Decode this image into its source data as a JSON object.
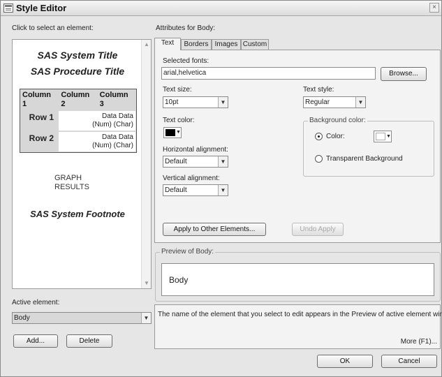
{
  "window": {
    "title": "Style Editor",
    "close": "×"
  },
  "left": {
    "select_label": "Click to select an element:",
    "preview": {
      "system_title": "SAS System Title",
      "procedure_title": "SAS Procedure Title",
      "headers": [
        "Column 1",
        "Column 2",
        "Column 3"
      ],
      "rows": [
        {
          "header": "Row 1",
          "line1": "Data Data",
          "line2": "(Num) (Char)"
        },
        {
          "header": "Row 2",
          "line1": "Data Data",
          "line2": "(Num) (Char)"
        }
      ],
      "graph": "GRAPH",
      "results": "RESULTS",
      "footnote": "SAS System Footnote"
    },
    "active_label": "Active element:",
    "active_value": "Body",
    "add_button": "Add...",
    "delete_button": "Delete"
  },
  "right": {
    "attributes_label": "Attributes for Body:",
    "tabs": [
      "Text",
      "Borders",
      "Images",
      "Custom"
    ],
    "selected_fonts_label": "Selected fonts:",
    "selected_fonts_value": "arial,helvetica",
    "browse_button": "Browse...",
    "text_size_label": "Text size:",
    "text_size_value": "10pt",
    "text_style_label": "Text style:",
    "text_style_value": "Regular",
    "text_color_label": "Text color:",
    "text_color_value": "#000000",
    "background_group_label": "Background color:",
    "color_radio_label": "Color:",
    "background_color_value": "#ffffff",
    "transparent_radio_label": "Transparent Background",
    "h_align_label": "Horizontal alignment:",
    "h_align_value": "Default",
    "v_align_label": "Vertical alignment:",
    "v_align_value": "Default",
    "apply_button": "Apply to Other Elements...",
    "undo_button": "Undo Apply",
    "preview_group_label": "Preview of Body:",
    "preview_text": "Body",
    "info_text": "The name of the element that you select to edit appears in the Preview of active element window.",
    "more_link": "More (F1)..."
  },
  "footer": {
    "ok_button": "OK",
    "cancel_button": "Cancel"
  }
}
